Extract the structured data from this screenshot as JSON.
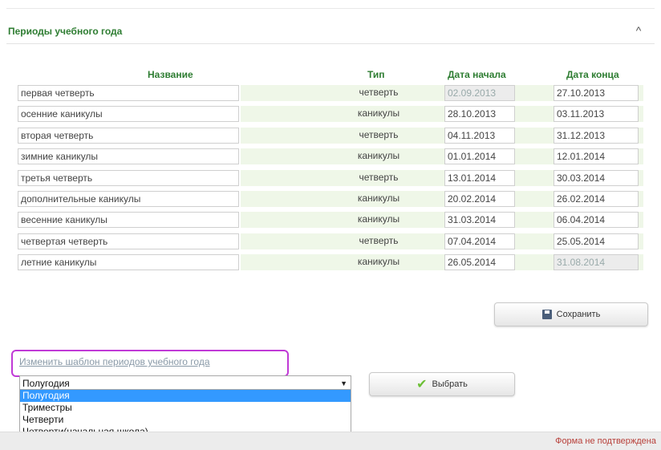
{
  "panel": {
    "title": "Периоды учебного года",
    "collapse_glyph": "^"
  },
  "table": {
    "headers": {
      "name": "Название",
      "type": "Тип",
      "start": "Дата начала",
      "end": "Дата конца"
    },
    "rows": [
      {
        "name": "первая четверть",
        "type": "четверть",
        "start": "02.09.2013",
        "end": "27.10.2013"
      },
      {
        "name": "осенние каникулы",
        "type": "каникулы",
        "start": "28.10.2013",
        "end": "03.11.2013"
      },
      {
        "name": "вторая четверть",
        "type": "четверть",
        "start": "04.11.2013",
        "end": "31.12.2013"
      },
      {
        "name": "зимние каникулы",
        "type": "каникулы",
        "start": "01.01.2014",
        "end": "12.01.2014"
      },
      {
        "name": "третья четверть",
        "type": "четверть",
        "start": "13.01.2014",
        "end": "30.03.2014"
      },
      {
        "name": "дополнительные каникулы",
        "type": "каникулы",
        "start": "20.02.2014",
        "end": "26.02.2014"
      },
      {
        "name": "весенние каникулы",
        "type": "каникулы",
        "start": "31.03.2014",
        "end": "06.04.2014"
      },
      {
        "name": "четвертая четверть",
        "type": "четверть",
        "start": "07.04.2014",
        "end": "25.05.2014"
      },
      {
        "name": "летние каникулы",
        "type": "каникулы",
        "start": "26.05.2014",
        "end": "31.08.2014"
      }
    ]
  },
  "actions": {
    "save_label": "Сохранить",
    "choose_label": "Выбрать"
  },
  "template": {
    "link_text": "Изменить шаблон периодов учебного года",
    "selected_value": "Полугодия",
    "options": [
      "Полугодия",
      "Триместры",
      "Четверти",
      "Четверти(начальная школа)"
    ]
  },
  "footer": {
    "status": "Форма не подтверждена"
  },
  "colors": {
    "accent_green": "#2e7d32",
    "row_tint": "#eff7e8",
    "highlight_border": "#c03ad6",
    "selected_option": "#3399ff",
    "status_red": "#b8403a"
  },
  "icons": {
    "save": "save-icon",
    "check": "check-icon",
    "collapse": "chevron-up-icon",
    "dropdown": "chevron-down-icon"
  }
}
